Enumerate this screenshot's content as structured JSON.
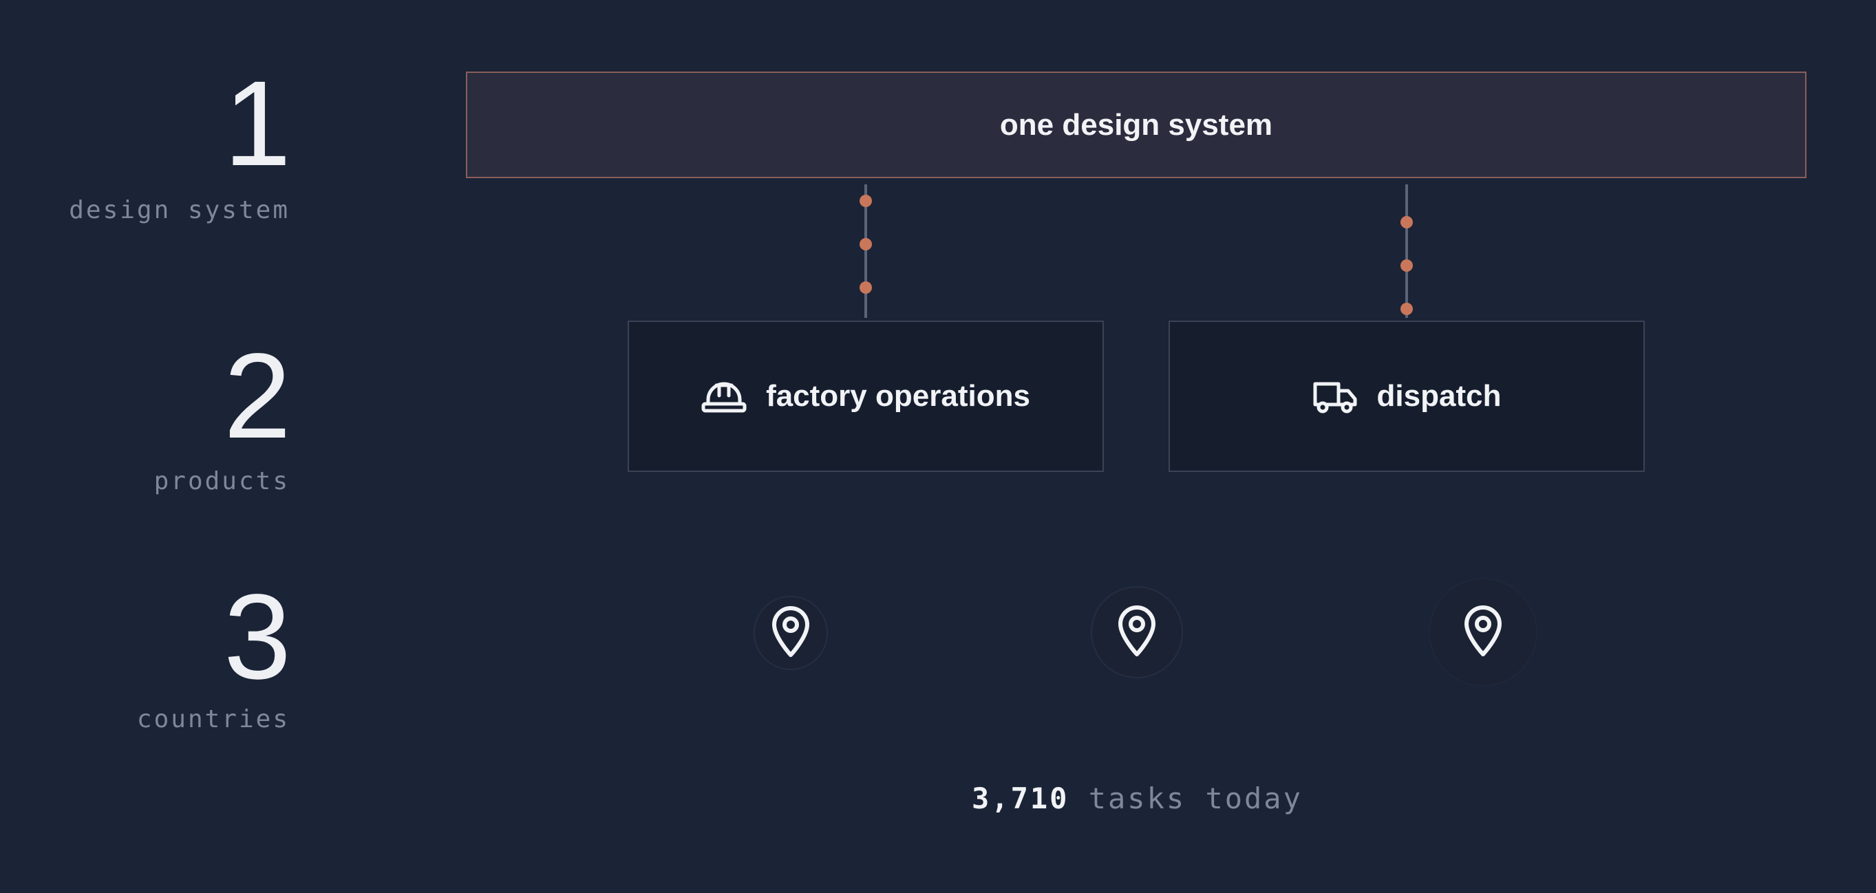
{
  "rows": [
    {
      "number": "1",
      "caption": "design system"
    },
    {
      "number": "2",
      "caption": "products"
    },
    {
      "number": "3",
      "caption": "countries"
    }
  ],
  "system": {
    "label": "one design system"
  },
  "products": [
    {
      "label": "factory operations",
      "icon": "hard-hat-icon"
    },
    {
      "label": "dispatch",
      "icon": "truck-icon"
    }
  ],
  "countries": [
    {
      "icon": "map-pin-icon"
    },
    {
      "icon": "map-pin-icon"
    },
    {
      "icon": "map-pin-icon"
    }
  ],
  "footer": {
    "count": "3,710",
    "label": "tasks today"
  },
  "colors": {
    "background": "#1b2336",
    "accent": "#c9775a",
    "system_border": "#8a5f5a",
    "muted_text": "#7f889a"
  }
}
